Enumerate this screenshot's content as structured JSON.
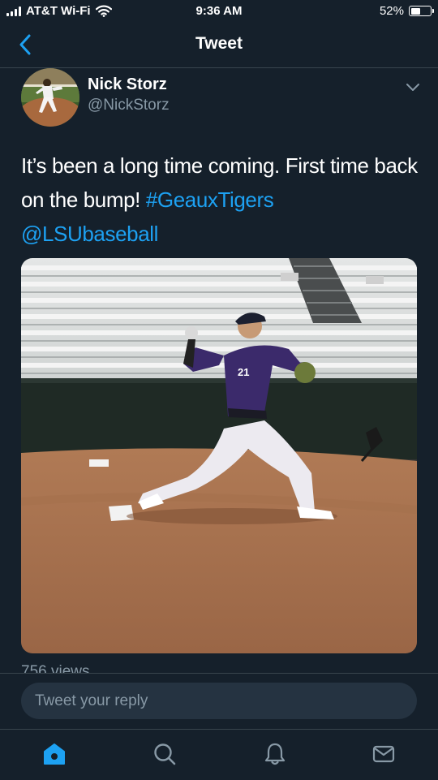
{
  "status_bar": {
    "carrier": "AT&T Wi-Fi",
    "time": "9:36 AM",
    "battery": "52%",
    "battery_level": 0.52
  },
  "header": {
    "title": "Tweet"
  },
  "tweet": {
    "author_name": "Nick Storz",
    "author_handle": "@NickStorz",
    "text_part1": "It’s been a long time coming. First time back on the bump!",
    "hashtag": "#GeauxTigers",
    "mention": "@LSUbaseball",
    "views": "756 views"
  },
  "media": {
    "jersey_number": "21"
  },
  "reply": {
    "placeholder": "Tweet your reply"
  },
  "colors": {
    "background": "#15202b",
    "accent": "#1da1f2",
    "secondary_text": "#8899a6"
  },
  "icons": {
    "back": "chevron-left-icon",
    "caret": "chevron-down-icon",
    "home": "home-icon",
    "search": "search-icon",
    "notifications": "bell-icon",
    "messages": "envelope-icon"
  }
}
